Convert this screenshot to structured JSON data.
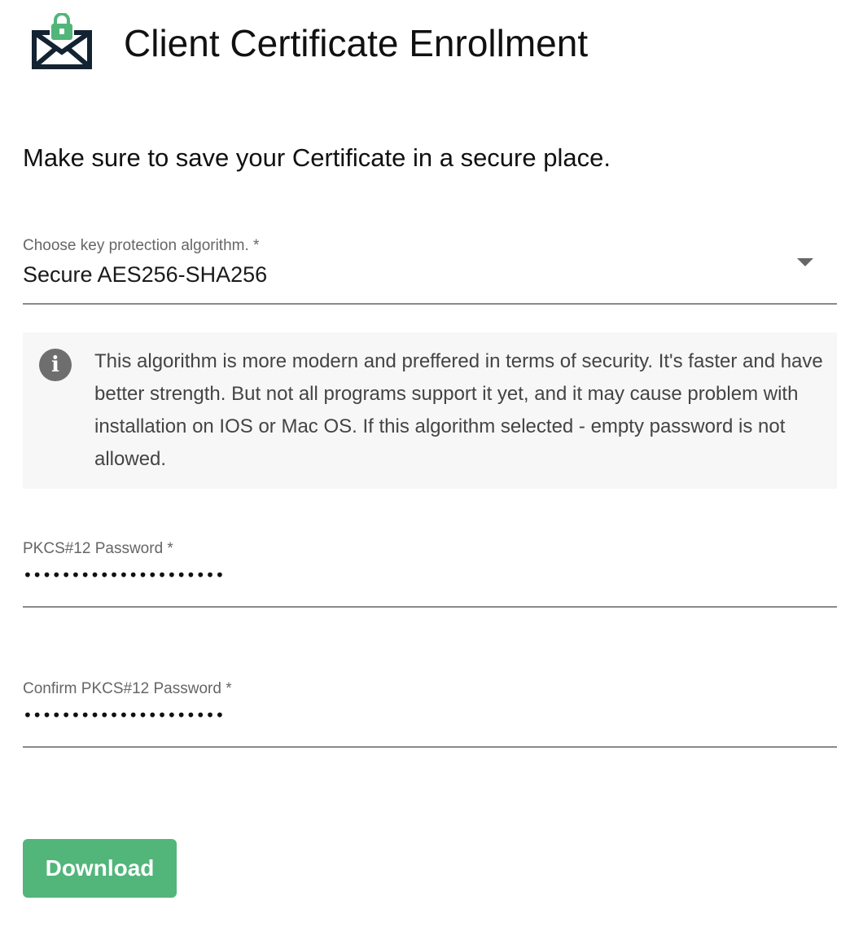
{
  "header": {
    "logo_icon": "envelope-lock-icon",
    "title": "Client Certificate Enrollment"
  },
  "subtitle": "Make sure to save your Certificate in a secure place.",
  "key_algorithm": {
    "label": "Choose key protection algorithm. *",
    "selected": "Secure AES256-SHA256",
    "arrow_icon": "dropdown-arrow-icon"
  },
  "info": {
    "icon": "info-icon",
    "icon_glyph": "i",
    "text": "This algorithm is more modern and preffered in terms of security. It's faster and have better strength. But not all programs support it yet, and it may cause problem with installation on IOS or Mac OS. If this algorithm selected - empty password is not allowed."
  },
  "password": {
    "label": "PKCS#12 Password *",
    "value": "•••••••••••••••••••••"
  },
  "confirm_password": {
    "label": "Confirm PKCS#12 Password *",
    "value": "•••••••••••••••••••••"
  },
  "download_label": "Download",
  "colors": {
    "brand_green": "#52b57a",
    "logo_navy": "#142332",
    "info_background": "#f7f7f7"
  }
}
